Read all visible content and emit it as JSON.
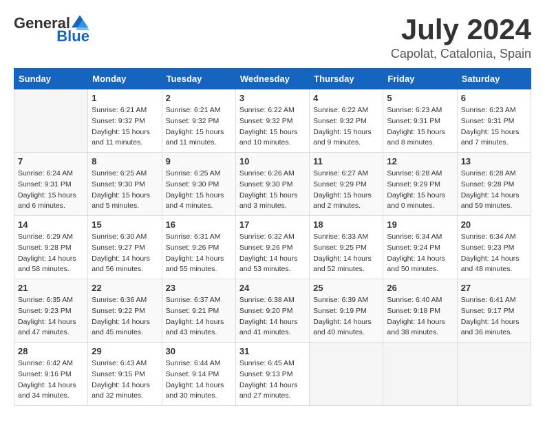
{
  "logo": {
    "text_general": "General",
    "text_blue": "Blue"
  },
  "header": {
    "month": "July 2024",
    "location": "Capolat, Catalonia, Spain"
  },
  "weekdays": [
    "Sunday",
    "Monday",
    "Tuesday",
    "Wednesday",
    "Thursday",
    "Friday",
    "Saturday"
  ],
  "weeks": [
    [
      {
        "day": "",
        "sunrise": "",
        "sunset": "",
        "daylight": ""
      },
      {
        "day": "1",
        "sunrise": "Sunrise: 6:21 AM",
        "sunset": "Sunset: 9:32 PM",
        "daylight": "Daylight: 15 hours and 11 minutes."
      },
      {
        "day": "2",
        "sunrise": "Sunrise: 6:21 AM",
        "sunset": "Sunset: 9:32 PM",
        "daylight": "Daylight: 15 hours and 11 minutes."
      },
      {
        "day": "3",
        "sunrise": "Sunrise: 6:22 AM",
        "sunset": "Sunset: 9:32 PM",
        "daylight": "Daylight: 15 hours and 10 minutes."
      },
      {
        "day": "4",
        "sunrise": "Sunrise: 6:22 AM",
        "sunset": "Sunset: 9:32 PM",
        "daylight": "Daylight: 15 hours and 9 minutes."
      },
      {
        "day": "5",
        "sunrise": "Sunrise: 6:23 AM",
        "sunset": "Sunset: 9:31 PM",
        "daylight": "Daylight: 15 hours and 8 minutes."
      },
      {
        "day": "6",
        "sunrise": "Sunrise: 6:23 AM",
        "sunset": "Sunset: 9:31 PM",
        "daylight": "Daylight: 15 hours and 7 minutes."
      }
    ],
    [
      {
        "day": "7",
        "sunrise": "Sunrise: 6:24 AM",
        "sunset": "Sunset: 9:31 PM",
        "daylight": "Daylight: 15 hours and 6 minutes."
      },
      {
        "day": "8",
        "sunrise": "Sunrise: 6:25 AM",
        "sunset": "Sunset: 9:30 PM",
        "daylight": "Daylight: 15 hours and 5 minutes."
      },
      {
        "day": "9",
        "sunrise": "Sunrise: 6:25 AM",
        "sunset": "Sunset: 9:30 PM",
        "daylight": "Daylight: 15 hours and 4 minutes."
      },
      {
        "day": "10",
        "sunrise": "Sunrise: 6:26 AM",
        "sunset": "Sunset: 9:30 PM",
        "daylight": "Daylight: 15 hours and 3 minutes."
      },
      {
        "day": "11",
        "sunrise": "Sunrise: 6:27 AM",
        "sunset": "Sunset: 9:29 PM",
        "daylight": "Daylight: 15 hours and 2 minutes."
      },
      {
        "day": "12",
        "sunrise": "Sunrise: 6:28 AM",
        "sunset": "Sunset: 9:29 PM",
        "daylight": "Daylight: 15 hours and 0 minutes."
      },
      {
        "day": "13",
        "sunrise": "Sunrise: 6:28 AM",
        "sunset": "Sunset: 9:28 PM",
        "daylight": "Daylight: 14 hours and 59 minutes."
      }
    ],
    [
      {
        "day": "14",
        "sunrise": "Sunrise: 6:29 AM",
        "sunset": "Sunset: 9:28 PM",
        "daylight": "Daylight: 14 hours and 58 minutes."
      },
      {
        "day": "15",
        "sunrise": "Sunrise: 6:30 AM",
        "sunset": "Sunset: 9:27 PM",
        "daylight": "Daylight: 14 hours and 56 minutes."
      },
      {
        "day": "16",
        "sunrise": "Sunrise: 6:31 AM",
        "sunset": "Sunset: 9:26 PM",
        "daylight": "Daylight: 14 hours and 55 minutes."
      },
      {
        "day": "17",
        "sunrise": "Sunrise: 6:32 AM",
        "sunset": "Sunset: 9:26 PM",
        "daylight": "Daylight: 14 hours and 53 minutes."
      },
      {
        "day": "18",
        "sunrise": "Sunrise: 6:33 AM",
        "sunset": "Sunset: 9:25 PM",
        "daylight": "Daylight: 14 hours and 52 minutes."
      },
      {
        "day": "19",
        "sunrise": "Sunrise: 6:34 AM",
        "sunset": "Sunset: 9:24 PM",
        "daylight": "Daylight: 14 hours and 50 minutes."
      },
      {
        "day": "20",
        "sunrise": "Sunrise: 6:34 AM",
        "sunset": "Sunset: 9:23 PM",
        "daylight": "Daylight: 14 hours and 48 minutes."
      }
    ],
    [
      {
        "day": "21",
        "sunrise": "Sunrise: 6:35 AM",
        "sunset": "Sunset: 9:23 PM",
        "daylight": "Daylight: 14 hours and 47 minutes."
      },
      {
        "day": "22",
        "sunrise": "Sunrise: 6:36 AM",
        "sunset": "Sunset: 9:22 PM",
        "daylight": "Daylight: 14 hours and 45 minutes."
      },
      {
        "day": "23",
        "sunrise": "Sunrise: 6:37 AM",
        "sunset": "Sunset: 9:21 PM",
        "daylight": "Daylight: 14 hours and 43 minutes."
      },
      {
        "day": "24",
        "sunrise": "Sunrise: 6:38 AM",
        "sunset": "Sunset: 9:20 PM",
        "daylight": "Daylight: 14 hours and 41 minutes."
      },
      {
        "day": "25",
        "sunrise": "Sunrise: 6:39 AM",
        "sunset": "Sunset: 9:19 PM",
        "daylight": "Daylight: 14 hours and 40 minutes."
      },
      {
        "day": "26",
        "sunrise": "Sunrise: 6:40 AM",
        "sunset": "Sunset: 9:18 PM",
        "daylight": "Daylight: 14 hours and 38 minutes."
      },
      {
        "day": "27",
        "sunrise": "Sunrise: 6:41 AM",
        "sunset": "Sunset: 9:17 PM",
        "daylight": "Daylight: 14 hours and 36 minutes."
      }
    ],
    [
      {
        "day": "28",
        "sunrise": "Sunrise: 6:42 AM",
        "sunset": "Sunset: 9:16 PM",
        "daylight": "Daylight: 14 hours and 34 minutes."
      },
      {
        "day": "29",
        "sunrise": "Sunrise: 6:43 AM",
        "sunset": "Sunset: 9:15 PM",
        "daylight": "Daylight: 14 hours and 32 minutes."
      },
      {
        "day": "30",
        "sunrise": "Sunrise: 6:44 AM",
        "sunset": "Sunset: 9:14 PM",
        "daylight": "Daylight: 14 hours and 30 minutes."
      },
      {
        "day": "31",
        "sunrise": "Sunrise: 6:45 AM",
        "sunset": "Sunset: 9:13 PM",
        "daylight": "Daylight: 14 hours and 27 minutes."
      },
      {
        "day": "",
        "sunrise": "",
        "sunset": "",
        "daylight": ""
      },
      {
        "day": "",
        "sunrise": "",
        "sunset": "",
        "daylight": ""
      },
      {
        "day": "",
        "sunrise": "",
        "sunset": "",
        "daylight": ""
      }
    ]
  ]
}
